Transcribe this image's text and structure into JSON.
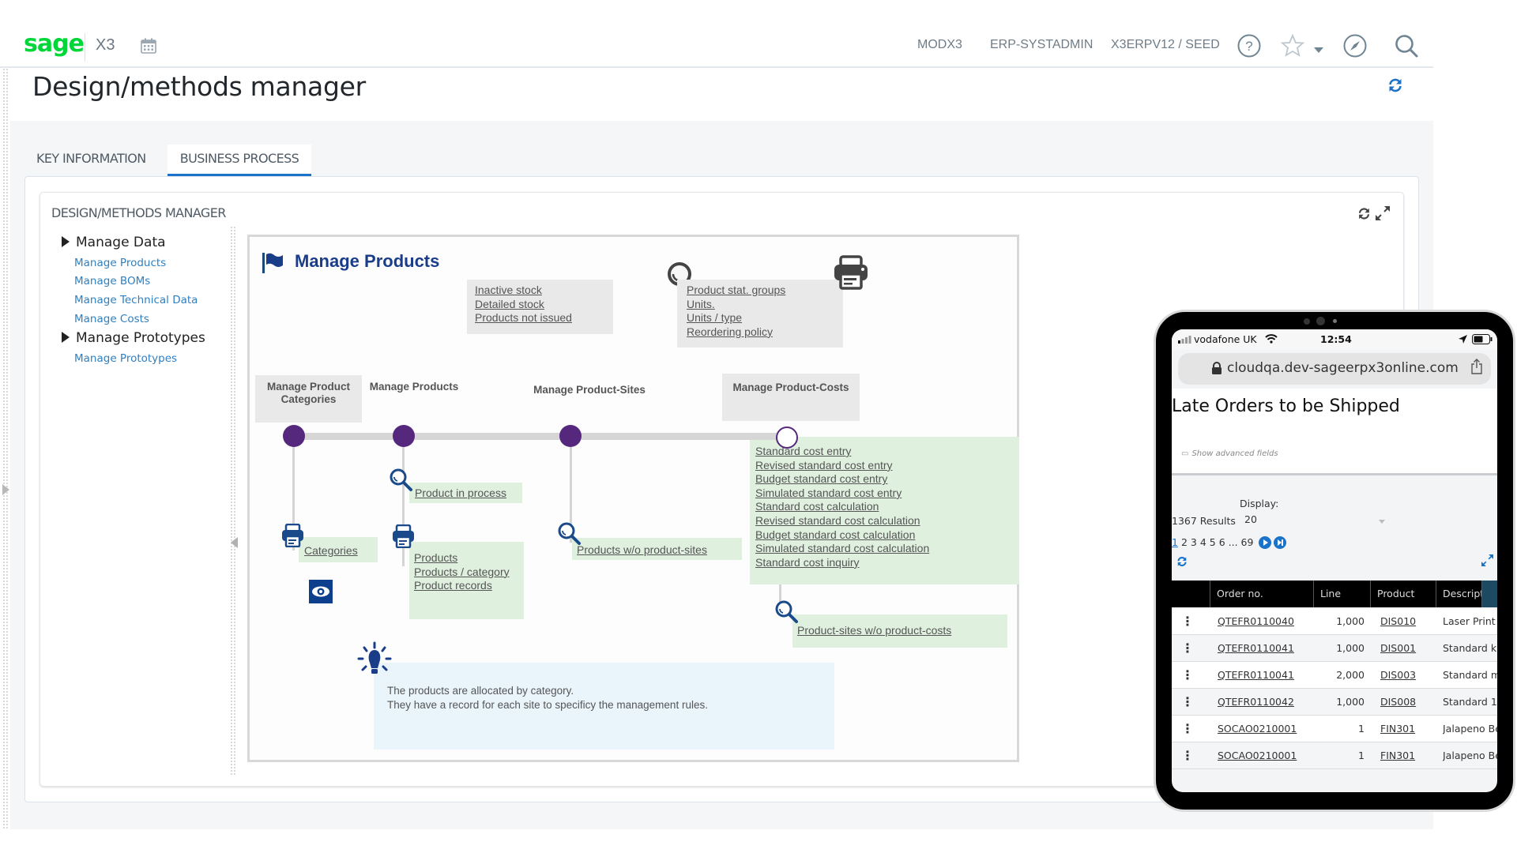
{
  "header": {
    "logo": "sage",
    "product": "X3",
    "links": [
      "MODX3",
      "ERP-SYSTADMIN",
      "X3ERPV12 / SEED"
    ],
    "icons": [
      "calendar-icon",
      "help-icon",
      "star-icon",
      "chevron-down-icon",
      "compass-icon",
      "search-icon"
    ]
  },
  "page": {
    "title": "Design/methods manager",
    "tabs": [
      {
        "label": "KEY INFORMATION",
        "active": false
      },
      {
        "label": "BUSINESS PROCESS",
        "active": true
      }
    ],
    "card_title": "DESIGN/METHODS MANAGER"
  },
  "tree": {
    "groups": [
      {
        "label": "Manage Data",
        "items": [
          "Manage Products",
          "Manage BOMs",
          "Manage Technical Data",
          "Manage Costs"
        ]
      },
      {
        "label": "Manage Prototypes",
        "items": [
          "Manage Prototypes"
        ]
      }
    ]
  },
  "diagram": {
    "title": "Manage Products",
    "inquiries_top": [
      "Inactive stock",
      "Detailed stock",
      "Products not issued"
    ],
    "reports_top": [
      "Product stat. groups",
      "Units.",
      "Units / type",
      "Reordering policy"
    ],
    "stages": [
      {
        "label": "Manage Product Categories",
        "line1": "Manage Product",
        "line2": "Categories"
      },
      {
        "label": "Manage Products"
      },
      {
        "label": "Manage Product-Sites"
      },
      {
        "label": "Manage Product-Costs"
      }
    ],
    "product_inquiry": "Product in process",
    "categories_report": "Categories",
    "products_reports": [
      "Products",
      "Products / category",
      "Product records"
    ],
    "sites_inquiry": "Products w/o product-sites",
    "cost_links": [
      "Standard cost entry",
      "Revised standard cost entry",
      "Budget standard cost entry",
      "Simulated standard cost entry",
      "Standard cost calculation",
      "Revised standard cost calculation",
      "Budget standard cost calculation",
      "Simulated standard cost calculation",
      "Standard cost inquiry"
    ],
    "costs_inquiry": "Product-sites w/o product-costs",
    "note_line1": "The products are allocated by category.",
    "note_line2": "They have a record for each site to specificy the management rules.",
    "colors": {
      "title": "#1a3d8a",
      "node": "#55287d",
      "green": "#e0f0df",
      "gray": "#e9e9e9",
      "note": "#e9f5fb"
    }
  },
  "mobile": {
    "carrier": "vodafone UK",
    "time": "12:54",
    "url": "cloudqa.dev-sageerpx3online.com",
    "title": "Late Orders to be Shipped",
    "advanced": "Show advanced fields",
    "results": "1367 Results",
    "display_label": "Display:",
    "display_value": "20",
    "pages": [
      "1",
      "2",
      "3",
      "4",
      "5",
      "6",
      "...",
      "69"
    ],
    "columns": [
      "Order no.",
      "Line",
      "Product",
      "Descripti"
    ],
    "rows": [
      {
        "order": "QTEFR0110040",
        "line": "1,000",
        "product": "DIS010",
        "desc": "Laser Print"
      },
      {
        "order": "QTEFR0110041",
        "line": "1,000",
        "product": "DIS001",
        "desc": "Standard k"
      },
      {
        "order": "QTEFR0110041",
        "line": "2,000",
        "product": "DIS003",
        "desc": "Standard m"
      },
      {
        "order": "QTEFR0110042",
        "line": "1,000",
        "product": "DIS008",
        "desc": "Standard 1"
      },
      {
        "order": "SOCAO0210001",
        "line": "1",
        "product": "FIN301",
        "desc": "Jalapeno Be"
      },
      {
        "order": "SOCAO0210001",
        "line": "1",
        "product": "FIN301",
        "desc": "Jalapeno Be"
      }
    ]
  }
}
